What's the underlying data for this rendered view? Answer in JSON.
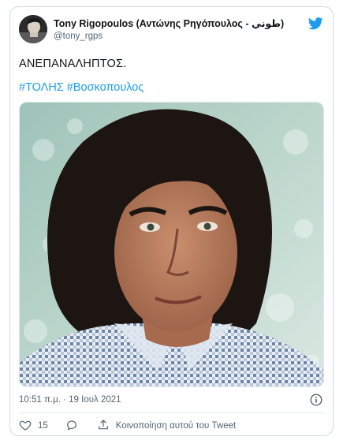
{
  "author": {
    "name": "Tony Rigopoulos (Αντώνης Ρηγόπουλος - طوني)",
    "handle": "@tony_rgps"
  },
  "tweet": {
    "text": "ΑΝΕΠΑΝΑΛΗΠΤΟΣ.",
    "hashtags": [
      "#ΤΟΛΗΣ",
      "#Βοσκοπουλος"
    ]
  },
  "meta": {
    "timestamp": "10:51 π.μ. · 19 Ιουλ 2021"
  },
  "actions": {
    "like_count": "15",
    "share_label": "Κοινοποίηση αυτού του Tweet"
  },
  "icons": {
    "brand": "twitter-bird-icon",
    "info": "info-icon",
    "like": "heart-icon",
    "reply": "reply-icon",
    "share": "share-icon"
  },
  "colors": {
    "twitter_blue": "#1d9bf0",
    "text_secondary": "#536471",
    "border": "#cfd9de"
  }
}
